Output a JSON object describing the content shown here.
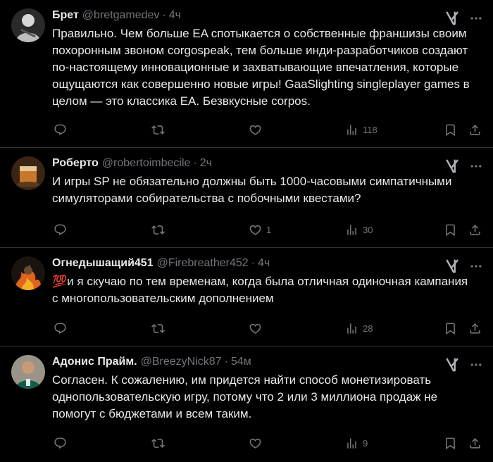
{
  "posts": [
    {
      "name": "Брет",
      "handle": "@bretgamedev",
      "time": "4ч",
      "text": "Правильно. Чем больше EA спотыкается о собственные франшизы своим похоронным звоном corgospeak, тем больше инди-разработчиков создают по-настоящему инновационные и захватывающие впечатления, которые ощущаются как совершенно новые игры! GaaSlighting singleplayer games в целом — это классика EA. Безвкусные corpos.",
      "replies": "",
      "reposts": "",
      "likes": "",
      "views": "118"
    },
    {
      "name": "Роберто",
      "handle": "@robertoimbecile",
      "time": "2ч",
      "text": "И игры SP не обязательно должны быть 1000-часовыми симпатичными симуляторами собирательства с побочными квестами?",
      "replies": "",
      "reposts": "",
      "likes": "1",
      "views": "30"
    },
    {
      "name": "Огнедышащий451",
      "handle": "@Firebreather452",
      "time": "4ч",
      "emoji": "💯",
      "text": "и я скучаю по тем временам, когда была отличная одиночная кампания с многопользовательским дополнением",
      "replies": "",
      "reposts": "",
      "likes": "",
      "views": "28"
    },
    {
      "name": "Адонис Прайм.",
      "handle": "@BreezyNick87",
      "time": "54м",
      "text": "Согласен. К сожалению, им придется найти способ монетизировать однопользовательскую игру, потому что 2 или 3 миллиона продаж не помогут с бюджетами и всем таким.",
      "replies": "",
      "reposts": "",
      "likes": "",
      "views": "9"
    }
  ],
  "separator": "·",
  "icons": {
    "reply": "reply-icon",
    "repost": "repost-icon",
    "like": "heart-icon",
    "views": "views-icon",
    "bookmark": "bookmark-icon",
    "share": "share-icon",
    "grok": "grok-icon",
    "more": "more-icon"
  },
  "colors": {
    "background": "#000000",
    "text": "#e7e9ea",
    "muted": "#71767b",
    "divider": "#2f3336"
  }
}
